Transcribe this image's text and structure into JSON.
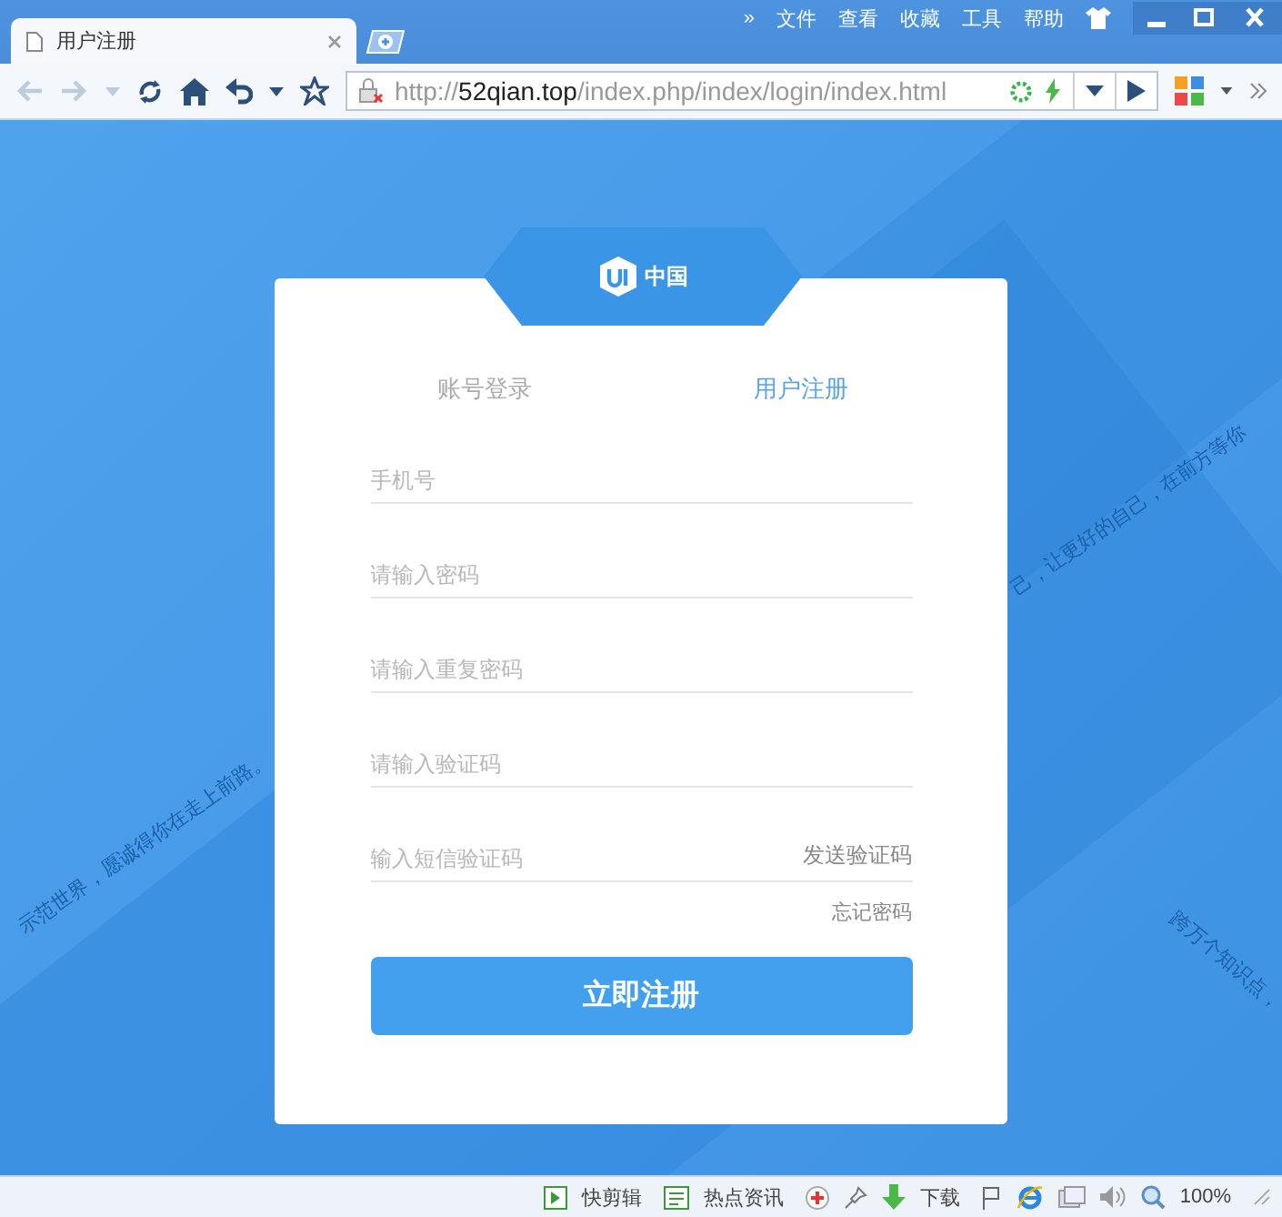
{
  "browser": {
    "tab": {
      "title": "用户注册",
      "selected": true
    },
    "menu": [
      "»",
      "文件",
      "查看",
      "收藏",
      "工具",
      "帮助"
    ],
    "address": "http://**52qian.top**/index.php/index/login/index.html"
  },
  "page": {
    "logo_text": "中国",
    "tabs": [
      {
        "label": "账号登录",
        "selected": false
      },
      {
        "label": "用户注册",
        "selected": true
      }
    ],
    "fields": [
      {
        "placeholder": "手机号"
      },
      {
        "placeholder": "请输入密码"
      },
      {
        "placeholder": "请输入重复密码"
      },
      {
        "placeholder": "请输入验证码"
      },
      {
        "placeholder": "输入短信验证码",
        "action": "发送验证码"
      }
    ],
    "forgot_link": "忘记密码",
    "submit": "立即注册",
    "background_texts": [
      "示范世界，愿诚得你在走上前路。",
      "己，让更好的自己，在前方等你",
      "跨万个知识点，"
    ]
  },
  "status_bar": {
    "items": [
      {
        "kind": "clip",
        "label": "快剪辑"
      },
      {
        "kind": "news",
        "label": "热点资讯"
      },
      {
        "kind": "download",
        "label": "下载"
      }
    ],
    "zoom": "100%"
  }
}
